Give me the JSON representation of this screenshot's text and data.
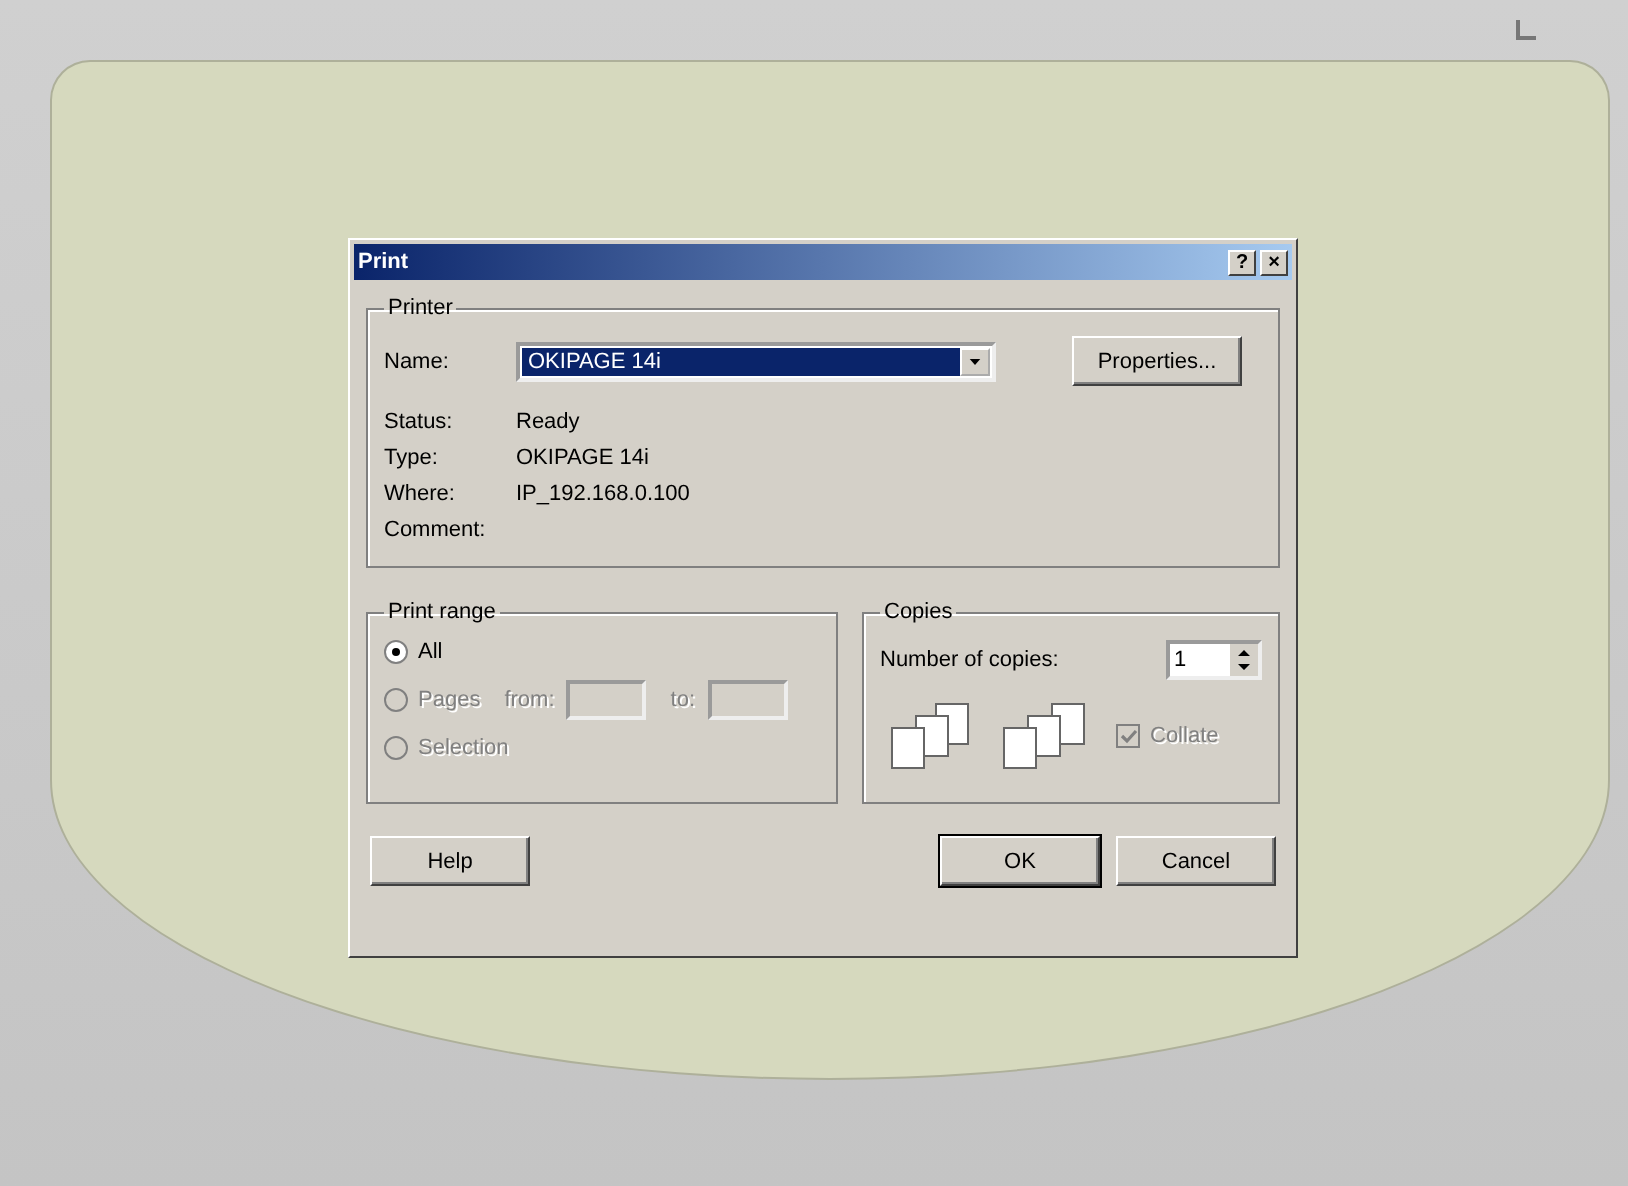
{
  "window": {
    "title": "Print",
    "help_button": "?",
    "close_button": "×"
  },
  "printer": {
    "group_label": "Printer",
    "name_label": "Name:",
    "name_value": "OKIPAGE 14i",
    "properties_button": "Properties...",
    "info": [
      {
        "label": "Status:",
        "value": "Ready"
      },
      {
        "label": "Type:",
        "value": "OKIPAGE 14i"
      },
      {
        "label": "Where:",
        "value": "IP_192.168.0.100"
      },
      {
        "label": "Comment:"
      }
    ]
  },
  "print_range": {
    "group_label": "Print range",
    "options": [
      {
        "label": "All",
        "selected": true,
        "disabled": false
      },
      {
        "label": "Pages",
        "selected": false,
        "disabled": true
      },
      {
        "label": "Selection",
        "selected": false,
        "disabled": true
      }
    ],
    "from_label": "from:",
    "to_label": "to:"
  },
  "copies": {
    "group_label": "Copies",
    "count_label": "Number of copies:",
    "count": "1",
    "collate": {
      "label": "Collate",
      "checked": true,
      "disabled": true
    }
  },
  "buttons": [
    {
      "label": "Help",
      "default": false
    },
    {
      "label": "OK",
      "default": true
    },
    {
      "label": "Cancel",
      "default": false
    }
  ]
}
